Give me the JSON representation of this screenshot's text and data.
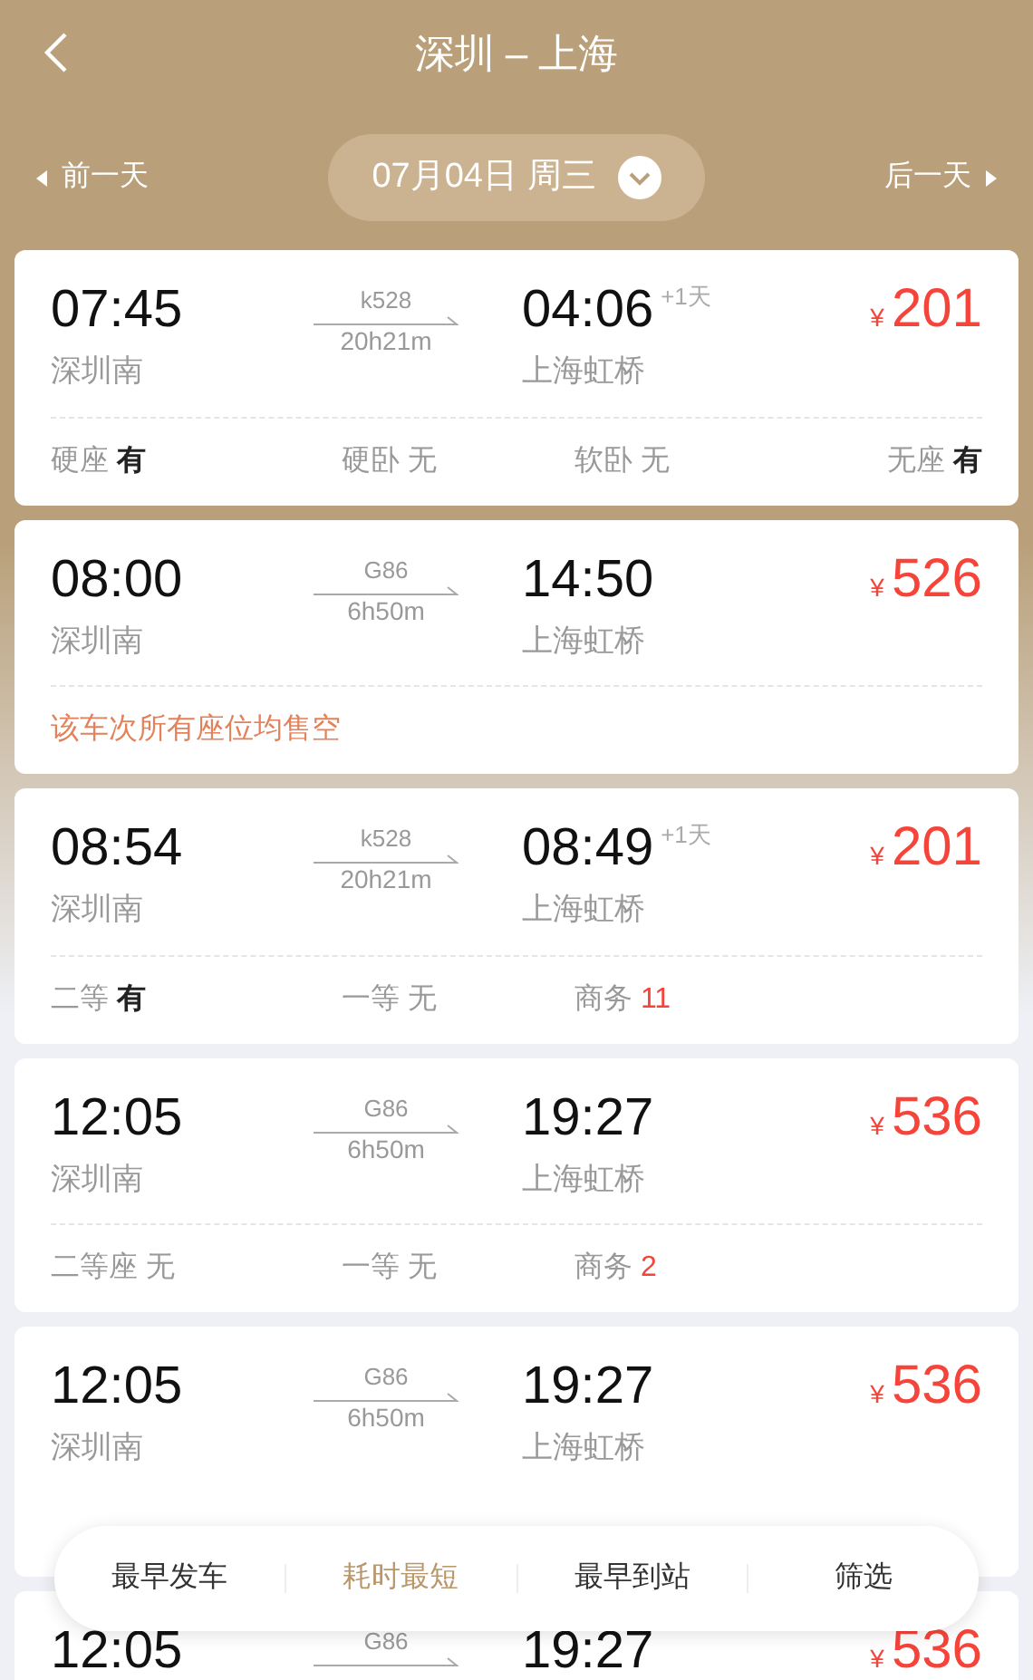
{
  "header": {
    "title": "深圳 – 上海"
  },
  "date_bar": {
    "prev": "前一天",
    "date": "07月04日 周三",
    "next": "后一天"
  },
  "trains": [
    {
      "depart": "07:45",
      "from": "深圳南",
      "train": "k528",
      "duration": "20h21m",
      "arrive": "04:06",
      "next_day": "+1天",
      "to": "上海虹桥",
      "currency": "¥",
      "price": "201",
      "seats": [
        {
          "name": "硬座",
          "status": "有",
          "kind": "available"
        },
        {
          "name": "硬卧",
          "status": "无",
          "kind": "none"
        },
        {
          "name": "软卧",
          "status": "无",
          "kind": "none"
        },
        {
          "name": "无座",
          "status": "有",
          "kind": "available"
        }
      ]
    },
    {
      "depart": "08:00",
      "from": "深圳南",
      "train": "G86",
      "duration": "6h50m",
      "arrive": "14:50",
      "to": "上海虹桥",
      "currency": "¥",
      "price": "526",
      "note": "该车次所有座位均售空"
    },
    {
      "depart": "08:54",
      "from": "深圳南",
      "train": "k528",
      "duration": "20h21m",
      "arrive": "08:49",
      "next_day": "+1天",
      "to": "上海虹桥",
      "currency": "¥",
      "price": "201",
      "seats": [
        {
          "name": "二等",
          "status": "有",
          "kind": "available"
        },
        {
          "name": "一等",
          "status": "无",
          "kind": "none"
        },
        {
          "name": "商务",
          "status": "11",
          "kind": "count"
        }
      ]
    },
    {
      "depart": "12:05",
      "from": "深圳南",
      "train": "G86",
      "duration": "6h50m",
      "arrive": "19:27",
      "to": "上海虹桥",
      "currency": "¥",
      "price": "536",
      "seats": [
        {
          "name": "二等座",
          "status": "无",
          "kind": "none"
        },
        {
          "name": "一等",
          "status": "无",
          "kind": "none"
        },
        {
          "name": "商务",
          "status": "2",
          "kind": "count"
        }
      ]
    },
    {
      "depart": "12:05",
      "from": "深圳南",
      "train": "G86",
      "duration": "6h50m",
      "arrive": "19:27",
      "to": "上海虹桥",
      "currency": "¥",
      "price": "536"
    },
    {
      "depart": "12:05",
      "train": "G86",
      "arrive": "19:27",
      "currency": "¥",
      "price": "536"
    }
  ],
  "sort_bar": [
    {
      "label": "最早发车",
      "selected": false
    },
    {
      "label": "耗时最短",
      "selected": true
    },
    {
      "label": "最早到站",
      "selected": false
    },
    {
      "label": "筛选",
      "selected": false
    }
  ]
}
